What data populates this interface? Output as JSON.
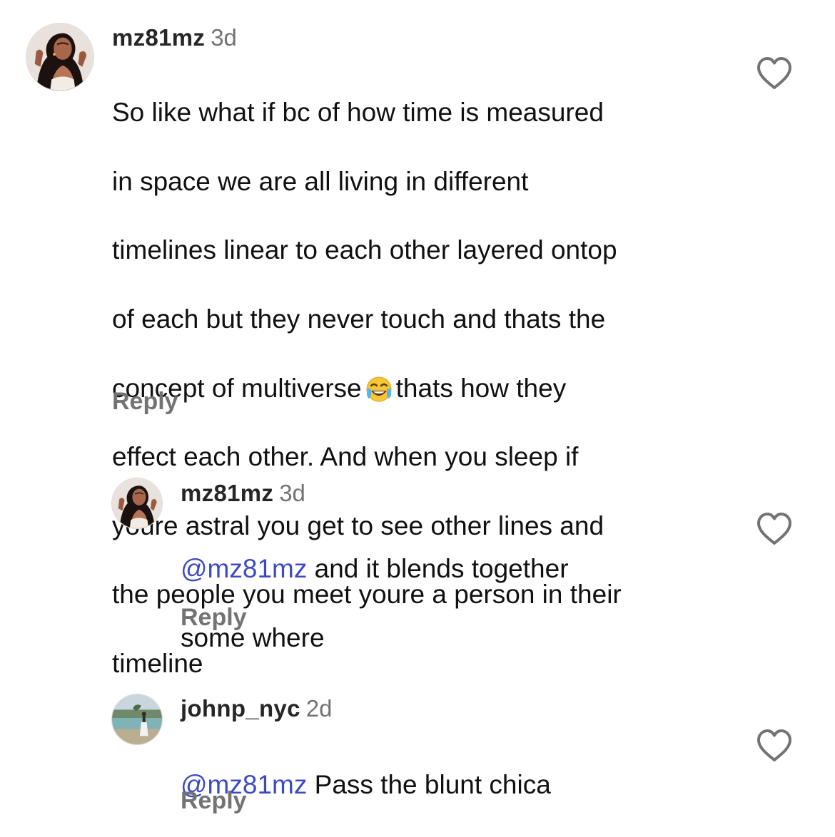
{
  "comments": [
    {
      "username": "mz81mz",
      "time": "3d",
      "lines": [
        "So like what if bc of how time is measured",
        "in space we are all living in different",
        "timelines linear to each other layered ontop",
        "of each but they never touch and  thats the"
      ],
      "line5_before": "concept of multiverse",
      "emoji": "face-with-tears-of-joy",
      "line5_after": "thats how they",
      "lines_tail": [
        "effect each other. And when you sleep if",
        "youre astral you get to see other lines and",
        "the people you meet youre a person in their",
        "timeline"
      ],
      "reply_label": "Reply"
    },
    {
      "username": "mz81mz",
      "time": "3d",
      "mention": "@mz81mz",
      "text_line1": " and it blends together",
      "text_line2": "some where",
      "reply_label": "Reply"
    },
    {
      "username": "johnp_nyc",
      "time": "2d",
      "mention": "@mz81mz",
      "text_line1": " Pass the blunt chica",
      "reply_label": "Reply"
    }
  ],
  "colors": {
    "mention": "#3d4ac4",
    "secondary_text": "#737373",
    "primary_text": "#111111",
    "heart_outline": "#737373"
  },
  "icons": {
    "like": "heart-outline-icon"
  }
}
